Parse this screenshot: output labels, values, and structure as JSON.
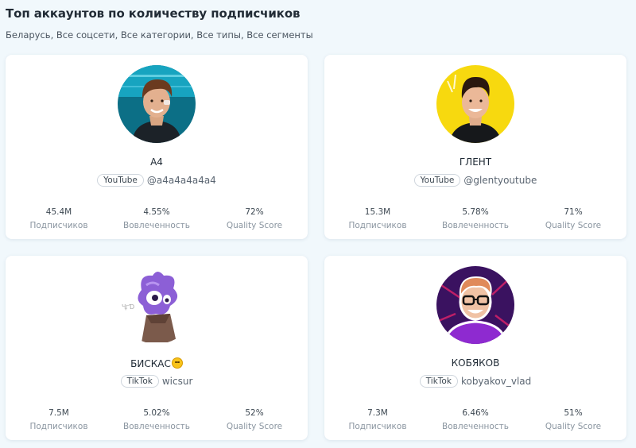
{
  "header": {
    "title": "Топ аккаунтов по количеству подписчиков",
    "filters": "Беларусь, Все соцсети, Все категории, Все типы, Все сегменты"
  },
  "stat_labels": {
    "subscribers": "Подписчиков",
    "engagement": "Вовлеченность",
    "quality": "Quality Score"
  },
  "accounts": [
    {
      "name": "A4",
      "platform": "YouTube",
      "handle": "@a4a4a4a4a4",
      "subscribers": "45.4M",
      "engagement": "4.55%",
      "quality": "72%",
      "avatar_icon": "person-avatar-teal"
    },
    {
      "name": "ГЛЕНТ",
      "platform": "YouTube",
      "handle": "@glentyoutube",
      "subscribers": "15.3M",
      "engagement": "5.78%",
      "quality": "71%",
      "avatar_icon": "person-avatar-yellow"
    },
    {
      "name": "БИСКАС",
      "platform": "TikTok",
      "handle": "wicsur",
      "subscribers": "7.5M",
      "engagement": "5.02%",
      "quality": "52%",
      "avatar_icon": "cartoon-avatar-purple"
    },
    {
      "name": "КОБЯКОВ",
      "platform": "TikTok",
      "handle": "kobyakov_vlad",
      "subscribers": "7.3M",
      "engagement": "6.46%",
      "quality": "51%",
      "avatar_icon": "person-avatar-purple"
    }
  ]
}
